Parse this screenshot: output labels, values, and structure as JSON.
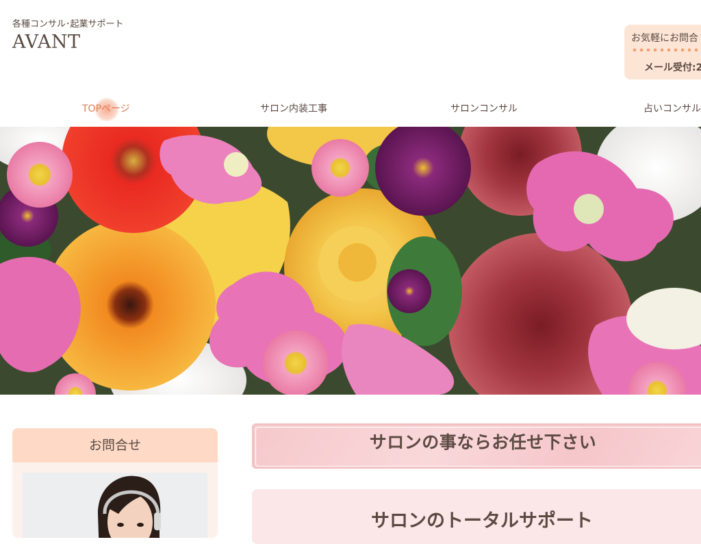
{
  "header": {
    "tagline": "各種コンサル･起業サポート",
    "logo": "AVANT",
    "contact_title": "お気軽にお問合",
    "contact_mail": "メール受付:2"
  },
  "nav": {
    "items": [
      {
        "label": "TOPページ",
        "active": true
      },
      {
        "label": "サロン内装工事",
        "active": false
      },
      {
        "label": "サロンコンサル",
        "active": false
      },
      {
        "label": "占いコンサル",
        "active": false
      }
    ]
  },
  "sidebar": {
    "heading": "お問合せ"
  },
  "main": {
    "banner_title": "サロンの事ならお任せ下さい",
    "card_title": "サロンのトータルサポート"
  },
  "colors": {
    "accent": "#e07b54",
    "text": "#5b4a42",
    "peach": "#fde5d6",
    "pink": "#f7cfd1"
  }
}
